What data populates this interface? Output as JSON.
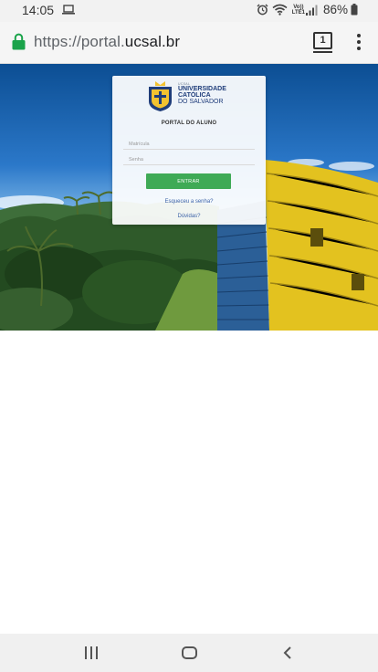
{
  "status_bar": {
    "time": "14:05",
    "battery": "86%",
    "icons": [
      "laptop-icon",
      "alarm-icon",
      "wifi-icon",
      "volte-icon",
      "signal-icon",
      "battery-icon"
    ],
    "volte_line1": "Vo))",
    "volte_line2": "LTE1"
  },
  "browser": {
    "url_prefix": "https://portal.",
    "url_domain": "ucsal.br",
    "tab_count": "1",
    "secure_color": "#1aa34a"
  },
  "login": {
    "logo": {
      "small_text": "UCSAL",
      "line1": "UNIVERSIDADE",
      "line2": "CATÓLICA",
      "line3": "DO SALVADOR"
    },
    "title": "PORTAL DO ALUNO",
    "matricula_placeholder": "Matrícula",
    "senha_placeholder": "Senha",
    "enter_label": "ENTRAR",
    "forgot_label": "Esqueceu a senha?",
    "help_label": "Dúvidas?",
    "button_color": "#3faa56"
  },
  "nav_bar": {
    "icons": [
      "recent-apps-icon",
      "home-icon",
      "back-icon"
    ]
  }
}
